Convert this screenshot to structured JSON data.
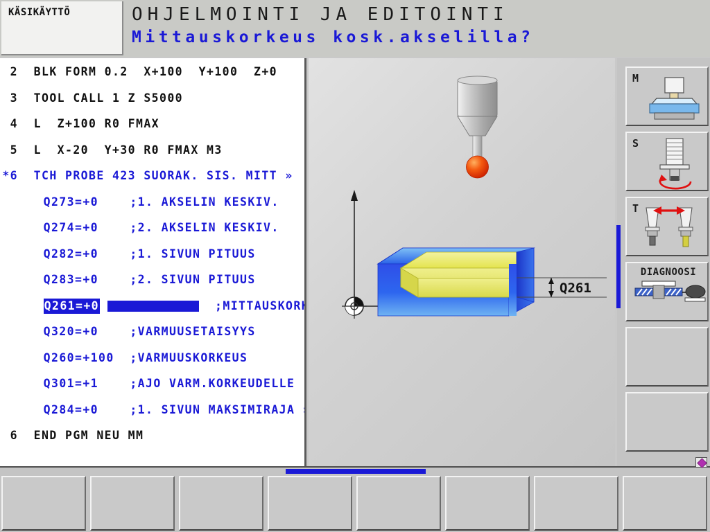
{
  "header": {
    "mode_tab": "KÄSIKÄYTTÖ",
    "title_main": "OHJELMOINTI JA EDITOINTI",
    "title_sub": "Mittauskorkeus kosk.akselilla?",
    "title_color": "#1a19d6"
  },
  "program": {
    "lines": [
      {
        "num": "2",
        "text": "BLK FORM 0.2  X+100  Y+100  Z+0",
        "color": "black",
        "indent": false,
        "highlight": false
      },
      {
        "num": "3",
        "text": "TOOL CALL 1 Z S5000",
        "color": "black",
        "indent": false,
        "highlight": false
      },
      {
        "num": "4",
        "text": "L  Z+100 R0 FMAX",
        "color": "black",
        "indent": false,
        "highlight": false
      },
      {
        "num": "5",
        "text": "L  X-20  Y+30 R0 FMAX M3",
        "color": "black",
        "indent": false,
        "highlight": false
      },
      {
        "num": "*6",
        "text": "TCH PROBE 423 SUORAK. SIS. MITT »",
        "color": "blue",
        "indent": false,
        "highlight": false
      },
      {
        "num": "",
        "text": "Q273=+0    ;1. AKSELIN KESKIV.",
        "color": "blue",
        "indent": true,
        "highlight": false
      },
      {
        "num": "",
        "text": "Q274=+0    ;2. AKSELIN KESKIV.",
        "color": "blue",
        "indent": true,
        "highlight": false
      },
      {
        "num": "",
        "text": "Q282=+0    ;1. SIVUN PITUUS",
        "color": "blue",
        "indent": true,
        "highlight": false
      },
      {
        "num": "",
        "text": "Q283=+0    ;2. SIVUN PITUUS",
        "color": "blue",
        "indent": true,
        "highlight": false
      },
      {
        "num": "",
        "text": "",
        "color": "blue",
        "indent": true,
        "highlight": true
      },
      {
        "num": "",
        "text": "Q320=+0    ;VARMUUSETAISYYS",
        "color": "blue",
        "indent": true,
        "highlight": false
      },
      {
        "num": "",
        "text": "Q260=+100  ;VARMUUSKORKEUS",
        "color": "blue",
        "indent": true,
        "highlight": false
      },
      {
        "num": "",
        "text": "Q301=+1    ;AJO VARM.KORKEUDELLE",
        "color": "blue",
        "indent": true,
        "highlight": false
      },
      {
        "num": "",
        "text": "Q284=+0    ;1. SIVUN MAKSIMIRAJA »",
        "color": "blue",
        "indent": true,
        "highlight": false
      },
      {
        "num": "6",
        "text": "END PGM NEU MM",
        "color": "black",
        "indent": false,
        "highlight": false
      }
    ],
    "active_line": {
      "label": "Q261=+0",
      "comment": ";MITTAUSKORKEUS",
      "cursor": "input-cursor"
    }
  },
  "graphic": {
    "dimension_label": "Q261",
    "origin_symbol": "workpiece-datum",
    "tool_symbol": "touch-probe",
    "workpiece_color": "#1f3fe0",
    "pocket_color": "#e8e864",
    "probe_ball_color": "#f03a0a"
  },
  "vertical_softkeys": [
    {
      "letter": "M",
      "label": "",
      "icon": "machine-table-icon"
    },
    {
      "letter": "S",
      "label": "",
      "icon": "spindle-speed-icon"
    },
    {
      "letter": "T",
      "label": "",
      "icon": "tool-change-icon"
    },
    {
      "letter": "",
      "label": "DIAGNOOSI",
      "icon": "diagnosis-icon"
    },
    {
      "letter": "",
      "label": "",
      "icon": ""
    },
    {
      "letter": "",
      "label": "",
      "icon": ""
    }
  ],
  "bottom_softkeys": [
    {
      "label": ""
    },
    {
      "label": ""
    },
    {
      "label": ""
    },
    {
      "label": ""
    },
    {
      "label": ""
    },
    {
      "label": ""
    },
    {
      "label": ""
    },
    {
      "label": ""
    }
  ],
  "indicators": {
    "bottom_page_marker": "softkey-row-3-of-8",
    "vertical_page_marker": "vertical-softkey-active"
  }
}
